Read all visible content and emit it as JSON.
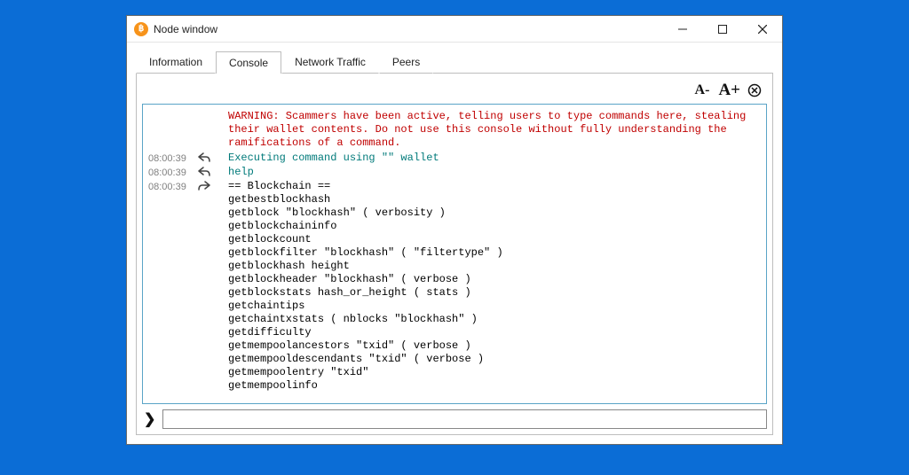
{
  "window": {
    "title": "Node window",
    "icon_glyph": "฿"
  },
  "tabs": [
    {
      "label": "Information",
      "active": false
    },
    {
      "label": "Console",
      "active": true
    },
    {
      "label": "Network Traffic",
      "active": false
    },
    {
      "label": "Peers",
      "active": false
    }
  ],
  "toolbar": {
    "font_dec": "A-",
    "font_inc": "A+"
  },
  "console": {
    "warning": "WARNING: Scammers have been active, telling users to type commands here, stealing their wallet contents. Do not use this console without fully understanding the ramifications of a command.",
    "rows": [
      {
        "ts": "08:00:39",
        "dir": "out",
        "color": "teal",
        "text": "Executing command using \"\" wallet"
      },
      {
        "ts": "08:00:39",
        "dir": "out",
        "color": "teal",
        "text": "help"
      },
      {
        "ts": "08:00:39",
        "dir": "in",
        "color": "black",
        "text": "== Blockchain ==\ngetbestblockhash\ngetblock \"blockhash\" ( verbosity )\ngetblockchaininfo\ngetblockcount\ngetblockfilter \"blockhash\" ( \"filtertype\" )\ngetblockhash height\ngetblockheader \"blockhash\" ( verbose )\ngetblockstats hash_or_height ( stats )\ngetchaintips\ngetchaintxstats ( nblocks \"blockhash\" )\ngetdifficulty\ngetmempoolancestors \"txid\" ( verbose )\ngetmempooldescendants \"txid\" ( verbose )\ngetmempoolentry \"txid\"\ngetmempoolinfo"
      }
    ]
  },
  "input": {
    "prompt": "❯",
    "value": ""
  }
}
